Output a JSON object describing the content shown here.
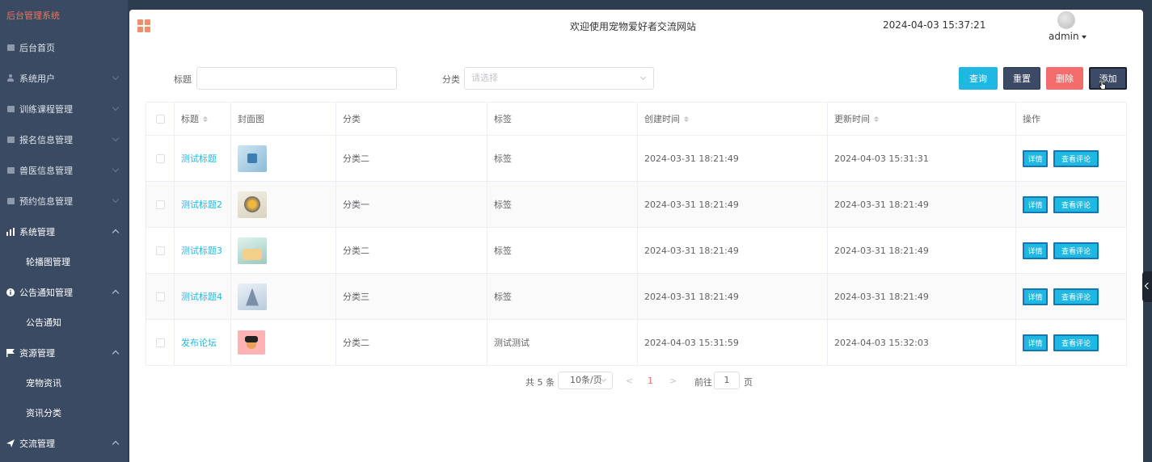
{
  "sidebar": {
    "brand": "后台管理系统",
    "items": [
      {
        "label": "后台首页",
        "icon": "monitor-icon"
      },
      {
        "label": "系统用户",
        "icon": "user-icon"
      },
      {
        "label": "训练课程管理",
        "icon": "square-icon"
      },
      {
        "label": "报名信息管理",
        "icon": "square-icon"
      },
      {
        "label": "兽医信息管理",
        "icon": "square-icon"
      },
      {
        "label": "预约信息管理",
        "icon": "square-icon"
      },
      {
        "label": "系统管理",
        "icon": "bar-chart-icon"
      },
      {
        "label": "轮播图管理"
      },
      {
        "label": "公告通知管理",
        "icon": "info-icon"
      },
      {
        "label": "公告通知"
      },
      {
        "label": "资源管理",
        "icon": "flag-icon"
      },
      {
        "label": "宠物资讯"
      },
      {
        "label": "资讯分类"
      },
      {
        "label": "交流管理",
        "icon": "send-icon"
      }
    ]
  },
  "header": {
    "welcome": "欢迎使用宠物爱好者交流网站",
    "datetime": "2024-04-03 15:37:21",
    "user": "admin"
  },
  "filter": {
    "title_label": "标题",
    "title_value": "",
    "category_label": "分类",
    "category_placeholder": "请选择",
    "buttons": {
      "query": "查询",
      "reset": "重置",
      "delete": "删除",
      "add": "添加"
    }
  },
  "table": {
    "columns": [
      "标题",
      "封面图",
      "分类",
      "标签",
      "创建时间",
      "更新时间",
      "操作"
    ],
    "rows": [
      {
        "title": "测试标题",
        "category": "分类二",
        "tag": "标签",
        "created": "2024-03-31 18:21:49",
        "updated": "2024-04-03 15:31:31"
      },
      {
        "title": "测试标题2",
        "category": "分类一",
        "tag": "标签",
        "created": "2024-03-31 18:21:49",
        "updated": "2024-03-31 18:21:49"
      },
      {
        "title": "测试标题3",
        "category": "分类二",
        "tag": "标签",
        "created": "2024-03-31 18:21:49",
        "updated": "2024-03-31 18:21:49"
      },
      {
        "title": "测试标题4",
        "category": "分类三",
        "tag": "标签",
        "created": "2024-03-31 18:21:49",
        "updated": "2024-03-31 18:21:49"
      },
      {
        "title": "发布论坛",
        "category": "分类二",
        "tag": "测试测试",
        "created": "2024-04-03 15:31:59",
        "updated": "2024-04-03 15:32:03"
      }
    ],
    "actions": {
      "detail": "详情",
      "comments": "查看评论"
    }
  },
  "pager": {
    "total": "共 5 条",
    "page_size": "10条/页",
    "prev": "<",
    "current": "1",
    "next": ">",
    "goto_label": "前往",
    "goto_value": "1",
    "page_unit": "页"
  }
}
